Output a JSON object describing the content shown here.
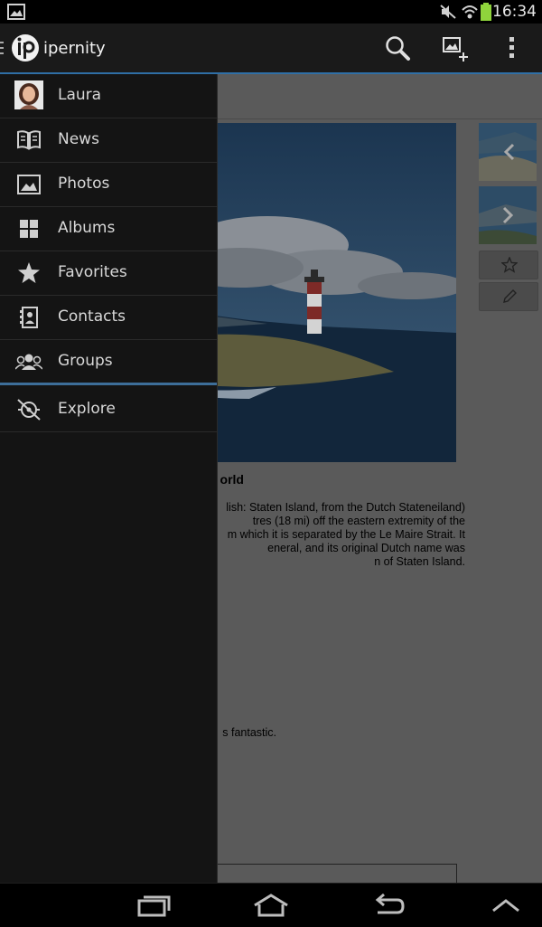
{
  "status_bar": {
    "time": "16:34",
    "icons": [
      "gallery-icon",
      "mute-icon",
      "wifi-icon",
      "battery-icon"
    ]
  },
  "action_bar": {
    "app_name": "ipernity",
    "actions": [
      "search-icon",
      "add-photo-icon",
      "overflow-menu-icon"
    ]
  },
  "drawer": {
    "user": {
      "name": "Laura"
    },
    "items": [
      {
        "label": "News",
        "icon": "book-icon"
      },
      {
        "label": "Photos",
        "icon": "photo-icon"
      },
      {
        "label": "Albums",
        "icon": "albums-grid-icon"
      },
      {
        "label": "Favorites",
        "icon": "star-icon"
      },
      {
        "label": "Contacts",
        "icon": "contacts-icon"
      },
      {
        "label": "Groups",
        "icon": "groups-icon"
      }
    ],
    "explore": {
      "label": "Explore",
      "icon": "compass-icon"
    }
  },
  "photo": {
    "title_fragment": "orld",
    "description_fragment": "lish: Staten Island, from the Dutch Stateneiland)\ntres (18 mi) off the eastern extremity of the\nm which it is separated by the Le Maire Strait. It\neneral, and its original Dutch name was\nn of Staten Island.",
    "comment_fragment": "s fantastic."
  },
  "colors": {
    "accent": "#3d6e99",
    "drawer_bg": "#141414",
    "action_bar_bg": "#1a1a1a"
  }
}
